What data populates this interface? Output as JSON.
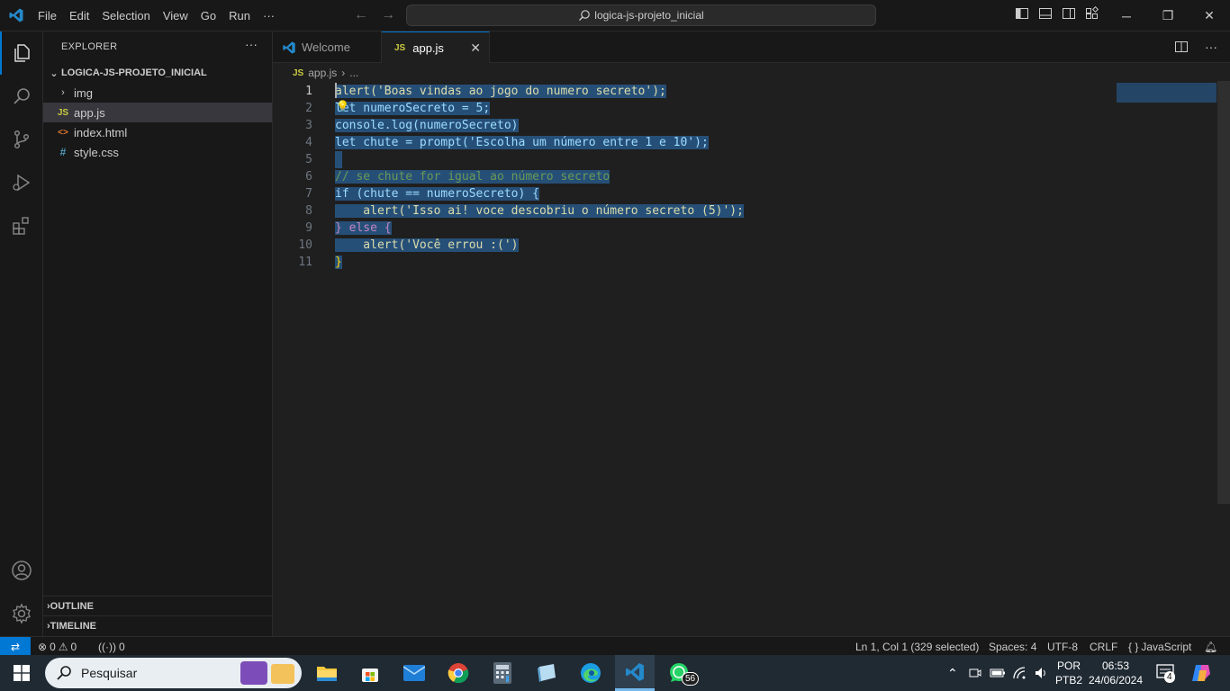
{
  "menu": [
    "File",
    "Edit",
    "Selection",
    "View",
    "Go",
    "Run",
    "···"
  ],
  "command_center": {
    "text": "logica-js-projeto_inicial"
  },
  "explorer": {
    "title": "EXPLORER",
    "more": "···",
    "folder": "LOGICA-JS-PROJETO_INICIAL",
    "items": [
      {
        "label": "img",
        "type": "folder"
      },
      {
        "label": "app.js",
        "type": "js",
        "icon_text": "JS"
      },
      {
        "label": "index.html",
        "type": "html",
        "icon_text": "<>"
      },
      {
        "label": "style.css",
        "type": "css",
        "icon_text": "#"
      }
    ],
    "outline": "OUTLINE",
    "timeline": "TIMELINE"
  },
  "tabs": [
    {
      "label": "Welcome",
      "active": false
    },
    {
      "label": "app.js",
      "active": true,
      "icon_text": "JS"
    }
  ],
  "breadcrumb": {
    "file": "app.js",
    "rest": "...",
    "icon_text": "JS"
  },
  "editor": {
    "line_numbers": [
      "1",
      "2",
      "3",
      "4",
      "5",
      "6",
      "7",
      "8",
      "9",
      "10",
      "11"
    ],
    "lines": [
      "alert('Boas vindas ao jogo do numero secreto');",
      "let numeroSecreto = 5;",
      "console.log(numeroSecreto)",
      "let chute = prompt('Escolha um número entre 1 e 10');",
      "",
      "// se chute for igual ao número secreto",
      "if (chute == numeroSecreto) {",
      "    alert('Isso ai! voce descobriu o número secreto (5)');",
      "} else {",
      "    alert('Você errou :(')",
      "}"
    ]
  },
  "statusbar": {
    "errors": "0",
    "warnings": "0",
    "ports": "0",
    "position": "Ln 1, Col 1 (329 selected)",
    "spaces": "Spaces: 4",
    "encoding": "UTF-8",
    "eol": "CRLF",
    "language": "JavaScript"
  },
  "taskbar": {
    "search_placeholder": "Pesquisar",
    "whatsapp_badge": "56",
    "lang_top": "POR",
    "lang_bottom": "PTB2",
    "time": "06:53",
    "date": "24/06/2024",
    "notification_count": "4"
  },
  "colors": {
    "accent": "#0078d4",
    "selection": "#264f78",
    "background": "#1f1f1f"
  }
}
